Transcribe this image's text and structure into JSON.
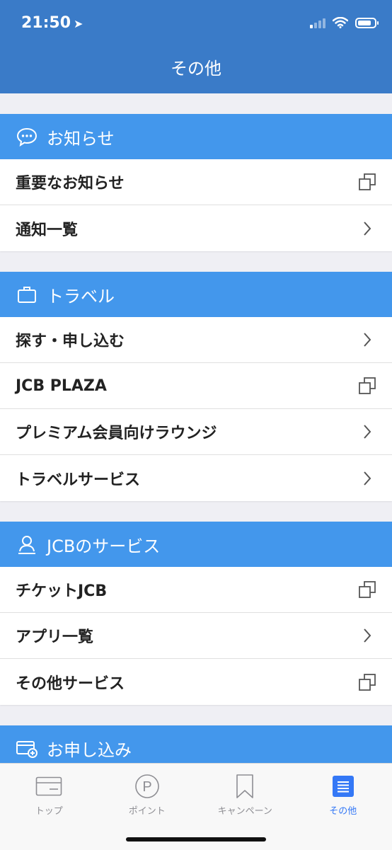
{
  "status": {
    "time": "21:50"
  },
  "nav": {
    "title": "その他"
  },
  "sections": [
    {
      "title": "お知らせ",
      "icon": "chat-bubble-icon",
      "items": [
        {
          "label": "重要なお知らせ",
          "action_icon": "external-window-icon"
        },
        {
          "label": "通知一覧",
          "action_icon": "chevron-right-icon"
        }
      ]
    },
    {
      "title": "トラベル",
      "icon": "suitcase-icon",
      "items": [
        {
          "label": "探す・申し込む",
          "action_icon": "chevron-right-icon"
        },
        {
          "label": "JCB PLAZA",
          "action_icon": "external-window-icon"
        },
        {
          "label": "プレミアム会員向けラウンジ",
          "action_icon": "chevron-right-icon"
        },
        {
          "label": "トラベルサービス",
          "action_icon": "chevron-right-icon"
        }
      ]
    },
    {
      "title": "JCBのサービス",
      "icon": "person-icon",
      "items": [
        {
          "label": "チケットJCB",
          "action_icon": "external-window-icon"
        },
        {
          "label": "アプリ一覧",
          "action_icon": "chevron-right-icon"
        },
        {
          "label": "その他サービス",
          "action_icon": "external-window-icon"
        }
      ]
    },
    {
      "title": "お申し込み",
      "icon": "card-add-icon",
      "items": []
    }
  ],
  "tabs": [
    {
      "label": "トップ",
      "icon": "card-icon",
      "active": false
    },
    {
      "label": "ポイント",
      "icon": "point-icon",
      "active": false
    },
    {
      "label": "キャンペーン",
      "icon": "bookmark-icon",
      "active": false
    },
    {
      "label": "その他",
      "icon": "menu-list-icon",
      "active": true
    }
  ],
  "colors": {
    "nav": "#3a7bc8",
    "section": "#4397ec",
    "active": "#3478f6"
  }
}
